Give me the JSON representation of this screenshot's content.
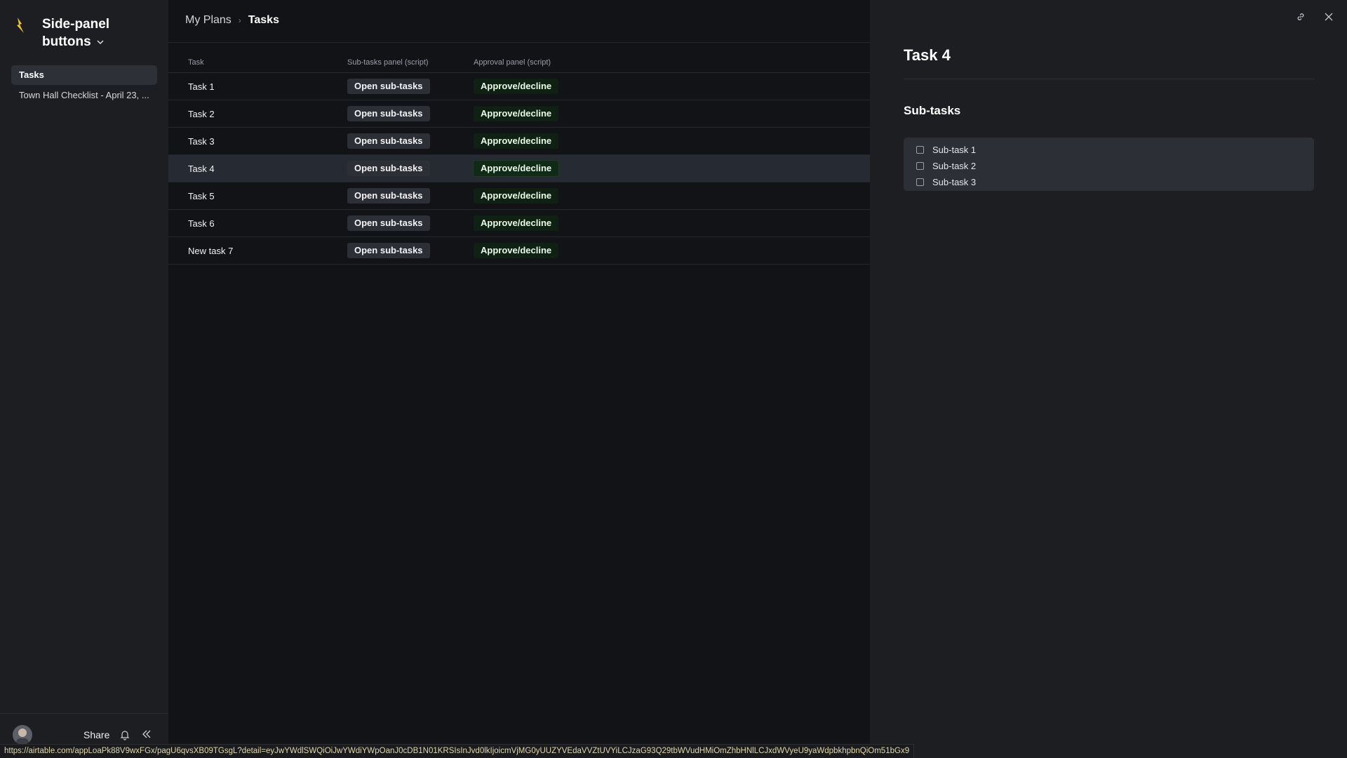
{
  "workspace": {
    "title": "Side-panel buttons"
  },
  "sidebar": {
    "items": [
      {
        "label": "Tasks",
        "active": true
      },
      {
        "label": "Town Hall Checklist - April 23, ..."
      }
    ],
    "footer": {
      "share_label": "Share"
    }
  },
  "breadcrumb": {
    "parent": "My Plans",
    "current": "Tasks"
  },
  "table": {
    "headers": [
      "Task",
      "Sub-tasks panel (script)",
      "Approval panel (script)"
    ],
    "rows": [
      {
        "task": "Task 1",
        "sub": "Open sub-tasks",
        "approve": "Approve/decline"
      },
      {
        "task": "Task 2",
        "sub": "Open sub-tasks",
        "approve": "Approve/decline"
      },
      {
        "task": "Task 3",
        "sub": "Open sub-tasks",
        "approve": "Approve/decline"
      },
      {
        "task": "Task 4",
        "sub": "Open sub-tasks",
        "approve": "Approve/decline",
        "selected": true
      },
      {
        "task": "Task 5",
        "sub": "Open sub-tasks",
        "approve": "Approve/decline"
      },
      {
        "task": "Task 6",
        "sub": "Open sub-tasks",
        "approve": "Approve/decline"
      },
      {
        "task": "New task 7",
        "sub": "Open sub-tasks",
        "approve": "Approve/decline"
      }
    ]
  },
  "panel": {
    "title": "Task 4",
    "subtasks_heading": "Sub-tasks",
    "subtasks": [
      "Sub-task 1",
      "Sub-task 2",
      "Sub-task 3"
    ]
  },
  "status_url": "https://airtable.com/appLoaPk88V9wxFGx/pagU6qvsXB09TGsgL?detail=eyJwYWdlSWQiOiJwYWdiYWpOanJ0cDB1N01KRSIsInJvd0lkIjoicmVjMG0yUUZYVEdaVVZtUVYiLCJzaG93Q29tbWVudHMiOmZhbHNlLCJxdWVyeU9yaWdpbkhpbnQiOm51bGx9",
  "colors": {
    "accent_logo": "#f2c230",
    "approve_bg": "#0e2112",
    "status_text": "#e3d7a8"
  }
}
